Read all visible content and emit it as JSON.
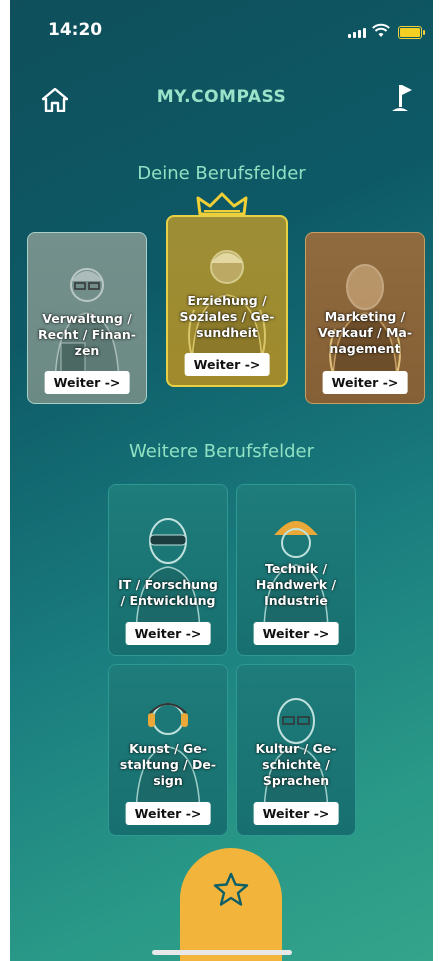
{
  "status_bar": {
    "time": "14:20"
  },
  "header": {
    "title": "MY.COMPASS",
    "home_icon": "home-icon",
    "flag_icon": "flag-icon"
  },
  "sections": {
    "primary_title": "Deine Berufsfelder",
    "secondary_title": "Weitere Berufsfelder"
  },
  "primary_cards": [
    {
      "label": "Verwaltung / Recht / Finan-zen",
      "button": "Weiter ->"
    },
    {
      "label": "Erziehung / Soziales / Ge-sundheit",
      "button": "Weiter ->",
      "highlighted": true
    },
    {
      "label": "Marketing / Verkauf / Ma-nagement",
      "button": "Weiter ->"
    }
  ],
  "secondary_cards": [
    {
      "label": "IT / Forschung / Entwicklung",
      "button": "Weiter ->"
    },
    {
      "label": "Technik / Handwerk / Industrie",
      "button": "Weiter ->"
    },
    {
      "label": "Kunst / Ge-staltung / De-sign",
      "button": "Weiter ->"
    },
    {
      "label": "Kultur / Ge-schichte / Sprachen",
      "button": "Weiter ->"
    }
  ],
  "colors": {
    "accent": "#f3b43b",
    "title": "#9be3c8",
    "card_primary_1": "#74908c",
    "card_primary_2": "#a08a2c",
    "card_primary_3": "#8f6b3f",
    "card_secondary": "#1e7c7b"
  },
  "bottom": {
    "favorite_icon": "star-icon"
  }
}
